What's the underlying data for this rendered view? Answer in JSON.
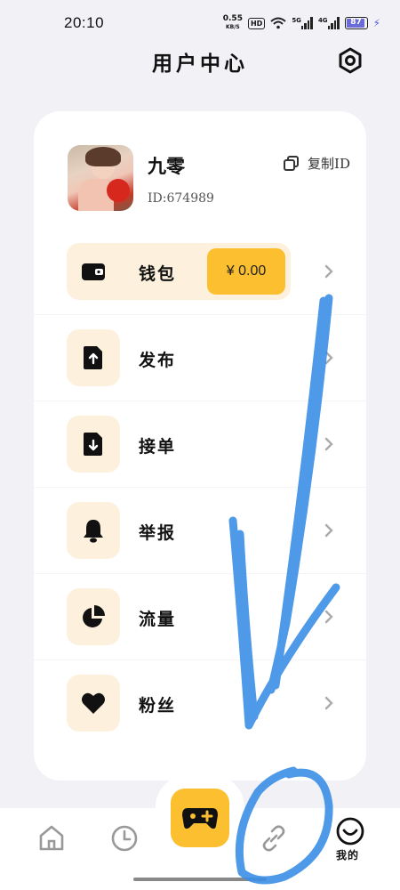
{
  "status_bar": {
    "time": "20:10",
    "net_speed_value": "0.55",
    "net_speed_unit": "KB/S",
    "hd_badge": "HD",
    "sig1_label": "5G",
    "sig2_label": "4G",
    "battery_level": "87"
  },
  "header": {
    "title": "用户中心",
    "settings_icon": "gear-icon"
  },
  "profile": {
    "username": "九零",
    "user_id": "ID:674989",
    "copy_label": "复制ID"
  },
  "menu": {
    "wallet": {
      "label": "钱包",
      "balance": "¥ 0.00",
      "icon": "wallet-icon"
    },
    "publish": {
      "label": "发布",
      "icon": "file-upload-icon"
    },
    "accept": {
      "label": "接单",
      "icon": "file-download-icon"
    },
    "report": {
      "label": "举报",
      "icon": "bell-icon"
    },
    "traffic": {
      "label": "流量",
      "icon": "pie-chart-icon"
    },
    "fans": {
      "label": "粉丝",
      "icon": "heart-icon"
    }
  },
  "bottom_nav": {
    "items": [
      {
        "icon": "home-icon"
      },
      {
        "icon": "clock-icon"
      },
      {
        "icon": "gamepad-icon"
      },
      {
        "icon": "link-icon"
      },
      {
        "icon": "smile-icon",
        "label": "我的"
      }
    ]
  },
  "colors": {
    "accent": "#fbbf2f",
    "icon_bg": "#fdf0dc",
    "page_bg": "#f2f2f6",
    "scribble": "#3b8fe6"
  }
}
